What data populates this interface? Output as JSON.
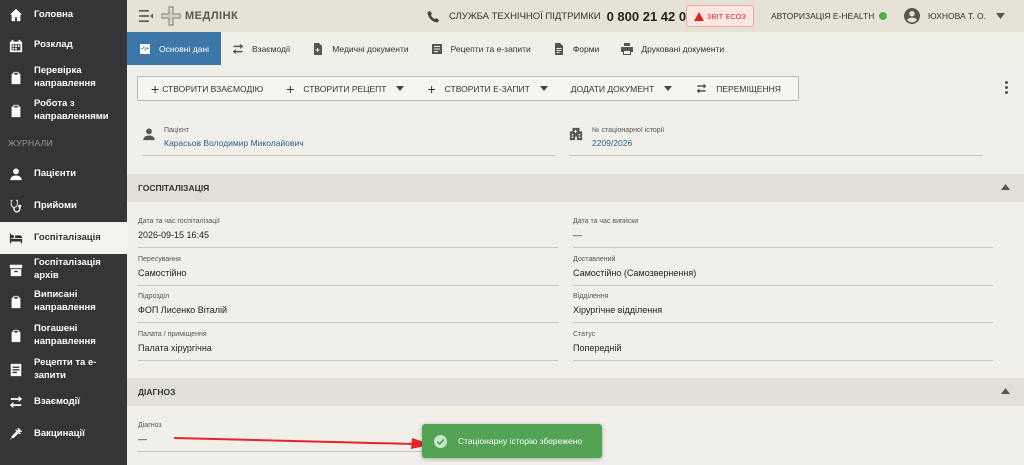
{
  "sidebar": {
    "items_top": [
      {
        "label": "Головна",
        "icon": "home-icon"
      },
      {
        "label": "Розклад",
        "icon": "calendar-icon"
      },
      {
        "label": "Перевірка направлення",
        "icon": "clipboard-icon"
      },
      {
        "label": "Робота з направленнями",
        "icon": "clipboard-icon"
      }
    ],
    "section_label": "ЖУРНАЛИ",
    "items_journal": [
      {
        "label": "Пацієнти",
        "icon": "person-icon"
      },
      {
        "label": "Прийоми",
        "icon": "stethoscope-icon"
      },
      {
        "label": "Госпіталізація",
        "icon": "bed-icon",
        "active": true
      },
      {
        "label": "Госпіталізація архів",
        "icon": "archive-icon"
      },
      {
        "label": "Виписані направлення",
        "icon": "clipboard-icon"
      },
      {
        "label": "Погашені направлення",
        "icon": "clipboard-icon"
      },
      {
        "label": "Рецепти та е-запити",
        "icon": "list-icon"
      },
      {
        "label": "Взаємодії",
        "icon": "swap-icon"
      },
      {
        "label": "Вакцинації",
        "icon": "syringe-icon"
      }
    ]
  },
  "topbar": {
    "logo_text": "МЕДЛІНК",
    "support_label": "СЛУЖБА ТЕХНІЧНОЇ ПІДТРИМКИ",
    "support_phone": "0 800 21 42 00",
    "report_button": "ЗВІТ ЕСОЗ",
    "ehealth_label": "АВТОРИЗАЦІЯ E-HEALTH",
    "user_name": "ЮХНОВА Т. О."
  },
  "tabs": [
    {
      "label": "Основні дані",
      "icon": "pulse-icon",
      "active": true
    },
    {
      "label": "Взаємодії",
      "icon": "swap-icon"
    },
    {
      "label": "Медичні документи",
      "icon": "document-add-icon"
    },
    {
      "label": "Рецепти та е-запити",
      "icon": "list-icon"
    },
    {
      "label": "Форми",
      "icon": "document-icon"
    },
    {
      "label": "Друковані документи",
      "icon": "printer-icon"
    }
  ],
  "toolbar": {
    "create_interaction": "СТВОРИТИ ВЗАЄМОДІЮ",
    "create_recipe": "СТВОРИТИ РЕЦЕПТ",
    "create_request": "СТВОРИТИ Е-ЗАПИТ",
    "add_document": "ДОДАТИ ДОКУМЕНТ",
    "transfer": "ПЕРЕМІЩЕННЯ"
  },
  "patient": {
    "label": "Пацієнт",
    "name": "Карасьов Володимир Миколайович",
    "history_label": "№ стаціонарної історії",
    "history_number": "2209/2026"
  },
  "hospitalization": {
    "title": "ГОСПІТАЛІЗАЦІЯ",
    "fields": [
      {
        "label": "Дата та час госпіталізації",
        "value": "2026-09-15 16:45"
      },
      {
        "label": "Дата та час виписки",
        "value": "—"
      },
      {
        "label": "Пересування",
        "value": "Самостійно"
      },
      {
        "label": "Доставлений",
        "value": "Самостійно (Самозвернення)"
      },
      {
        "label": "Підрозділ",
        "value": "ФОП Лисенко Віталій"
      },
      {
        "label": "Відділення",
        "value": "Хірургічне відділення"
      },
      {
        "label": "Палата / приміщення",
        "value": "Палата хірургічна"
      },
      {
        "label": "Статус",
        "value": "Попередній"
      }
    ]
  },
  "diagnosis": {
    "title": "ДІАГНОЗ",
    "label": "Діагноз",
    "value": "—"
  },
  "toast": {
    "message": "Стаціонарну історію збережено"
  },
  "colors": {
    "sidebar_bg": "#333537",
    "active_tab": "#3d77a8",
    "toast_green": "#52a454",
    "arrow_red": "#e3262c",
    "status_green": "#4caf50"
  }
}
